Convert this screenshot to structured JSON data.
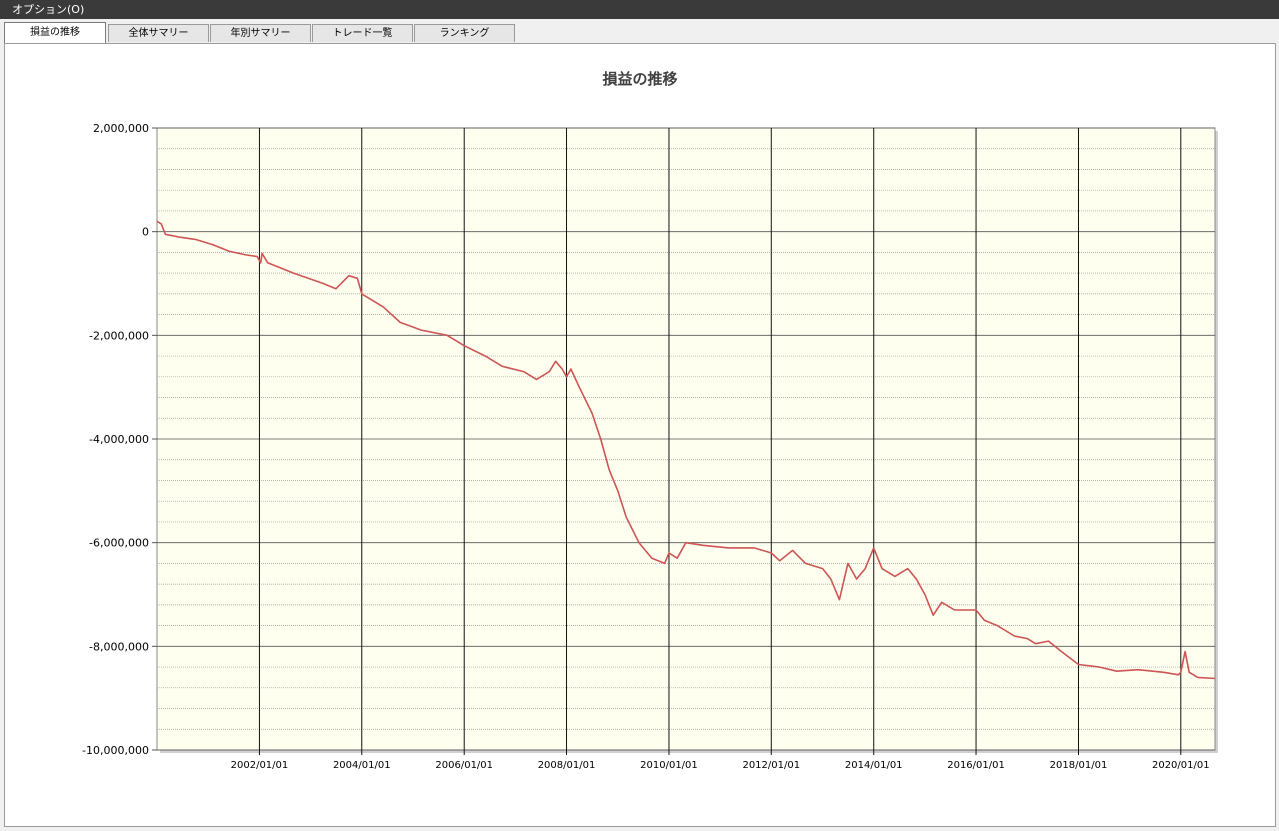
{
  "menubar": {
    "options_label": "オプション(O)"
  },
  "tabs": [
    {
      "label": "損益の推移",
      "active": true
    },
    {
      "label": "全体サマリー",
      "active": false
    },
    {
      "label": "年別サマリー",
      "active": false
    },
    {
      "label": "トレード一覧",
      "active": false
    },
    {
      "label": "ランキング",
      "active": false
    }
  ],
  "chart_data": {
    "type": "line",
    "title": "損益の推移",
    "xlabel": "",
    "ylabel": "",
    "xlim": [
      "2000/01/01",
      "2020/09/01"
    ],
    "ylim": [
      -10000000,
      2000000
    ],
    "y_ticks": [
      2000000,
      0,
      -2000000,
      -4000000,
      -6000000,
      -8000000,
      -10000000
    ],
    "y_tick_labels": [
      "2,000,000",
      "0",
      "-2,000,000",
      "-4,000,000",
      "-6,000,000",
      "-8,000,000",
      "-10,000,000"
    ],
    "x_ticks": [
      "2002/01/01",
      "2004/01/01",
      "2006/01/01",
      "2008/01/01",
      "2010/01/01",
      "2012/01/01",
      "2014/01/01",
      "2016/01/01",
      "2018/01/01",
      "2020/01/01"
    ],
    "grid": true,
    "legend": "none",
    "colors": {
      "line": "#cc5555",
      "plot_background": "#fffff0"
    },
    "series": [
      {
        "points": [
          [
            "2000/01/01",
            200000
          ],
          [
            "2000/02/01",
            150000
          ],
          [
            "2000/03/01",
            -50000
          ],
          [
            "2000/06/01",
            -100000
          ],
          [
            "2000/10/01",
            -150000
          ],
          [
            "2001/02/01",
            -250000
          ],
          [
            "2001/06/01",
            -380000
          ],
          [
            "2001/10/01",
            -450000
          ],
          [
            "2001/12/15",
            -480000
          ],
          [
            "2002/01/10",
            -600000
          ],
          [
            "2002/01/20",
            -420000
          ],
          [
            "2002/03/01",
            -600000
          ],
          [
            "2002/09/01",
            -800000
          ],
          [
            "2003/04/01",
            -1000000
          ],
          [
            "2003/07/01",
            -1100000
          ],
          [
            "2003/10/01",
            -850000
          ],
          [
            "2003/12/01",
            -900000
          ],
          [
            "2004/01/01",
            -1200000
          ],
          [
            "2004/06/01",
            -1450000
          ],
          [
            "2004/10/01",
            -1750000
          ],
          [
            "2005/03/01",
            -1900000
          ],
          [
            "2005/09/01",
            -2000000
          ],
          [
            "2006/01/01",
            -2200000
          ],
          [
            "2006/06/01",
            -2400000
          ],
          [
            "2006/10/01",
            -2600000
          ],
          [
            "2007/03/01",
            -2700000
          ],
          [
            "2007/06/01",
            -2850000
          ],
          [
            "2007/09/01",
            -2700000
          ],
          [
            "2007/10/15",
            -2500000
          ],
          [
            "2007/12/01",
            -2650000
          ],
          [
            "2008/01/01",
            -2800000
          ],
          [
            "2008/02/01",
            -2650000
          ],
          [
            "2008/04/01",
            -3000000
          ],
          [
            "2008/07/01",
            -3500000
          ],
          [
            "2008/09/01",
            -4000000
          ],
          [
            "2008/11/01",
            -4600000
          ],
          [
            "2009/01/01",
            -5000000
          ],
          [
            "2009/03/01",
            -5500000
          ],
          [
            "2009/06/01",
            -6000000
          ],
          [
            "2009/09/01",
            -6300000
          ],
          [
            "2009/12/01",
            -6400000
          ],
          [
            "2010/01/01",
            -6200000
          ],
          [
            "2010/03/01",
            -6300000
          ],
          [
            "2010/05/01",
            -6000000
          ],
          [
            "2010/09/01",
            -6050000
          ],
          [
            "2011/03/01",
            -6100000
          ],
          [
            "2011/09/01",
            -6100000
          ],
          [
            "2012/01/01",
            -6200000
          ],
          [
            "2012/03/01",
            -6350000
          ],
          [
            "2012/06/01",
            -6150000
          ],
          [
            "2012/09/01",
            -6400000
          ],
          [
            "2013/01/01",
            -6500000
          ],
          [
            "2013/03/01",
            -6700000
          ],
          [
            "2013/05/01",
            -7100000
          ],
          [
            "2013/07/01",
            -6400000
          ],
          [
            "2013/09/01",
            -6700000
          ],
          [
            "2013/11/01",
            -6500000
          ],
          [
            "2014/01/01",
            -6100000
          ],
          [
            "2014/03/01",
            -6500000
          ],
          [
            "2014/06/01",
            -6650000
          ],
          [
            "2014/09/01",
            -6500000
          ],
          [
            "2014/11/01",
            -6700000
          ],
          [
            "2015/01/01",
            -7000000
          ],
          [
            "2015/03/01",
            -7400000
          ],
          [
            "2015/05/01",
            -7150000
          ],
          [
            "2015/08/01",
            -7300000
          ],
          [
            "2016/01/01",
            -7300000
          ],
          [
            "2016/03/01",
            -7500000
          ],
          [
            "2016/06/01",
            -7600000
          ],
          [
            "2016/10/01",
            -7800000
          ],
          [
            "2017/01/01",
            -7850000
          ],
          [
            "2017/03/01",
            -7950000
          ],
          [
            "2017/06/01",
            -7900000
          ],
          [
            "2017/09/01",
            -8100000
          ],
          [
            "2018/01/01",
            -8350000
          ],
          [
            "2018/06/01",
            -8400000
          ],
          [
            "2018/10/01",
            -8480000
          ],
          [
            "2019/03/01",
            -8450000
          ],
          [
            "2019/09/01",
            -8500000
          ],
          [
            "2019/12/15",
            -8550000
          ],
          [
            "2020/01/01",
            -8500000
          ],
          [
            "2020/02/01",
            -8100000
          ],
          [
            "2020/03/01",
            -8500000
          ],
          [
            "2020/05/01",
            -8600000
          ],
          [
            "2020/09/01",
            -8620000
          ]
        ]
      }
    ]
  }
}
